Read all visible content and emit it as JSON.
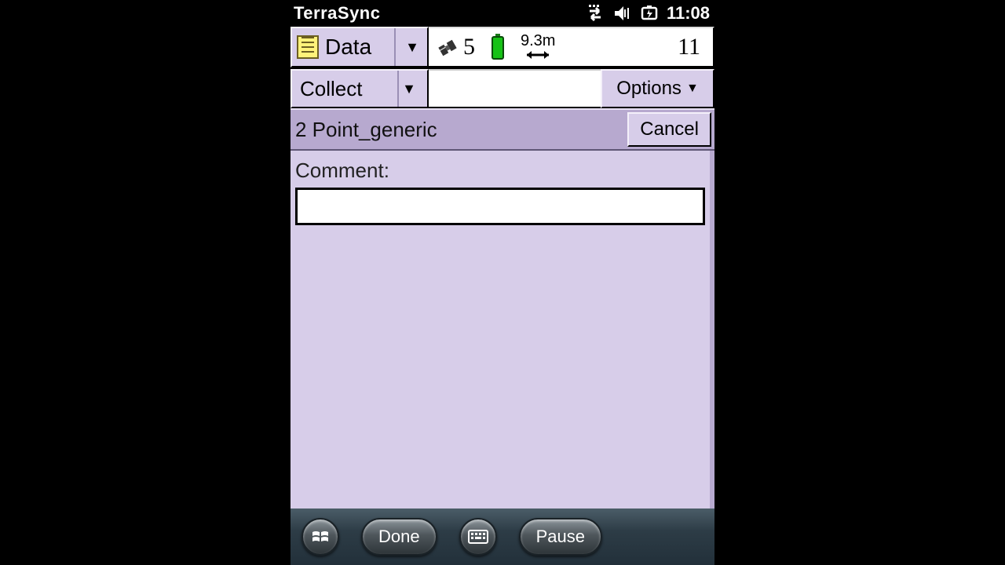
{
  "status": {
    "app_title": "TerraSync",
    "clock": "11:08"
  },
  "toolbar": {
    "data_label": "Data",
    "collect_label": "Collect",
    "options_label": "Options"
  },
  "gps": {
    "satellite_count": "5",
    "accuracy": "9.3m",
    "logged_count": "11"
  },
  "feature": {
    "title": "2 Point_generic",
    "cancel_label": "Cancel"
  },
  "form": {
    "comment_label": "Comment:",
    "comment_value": ""
  },
  "sysbar": {
    "done_label": "Done",
    "pause_label": "Pause"
  }
}
